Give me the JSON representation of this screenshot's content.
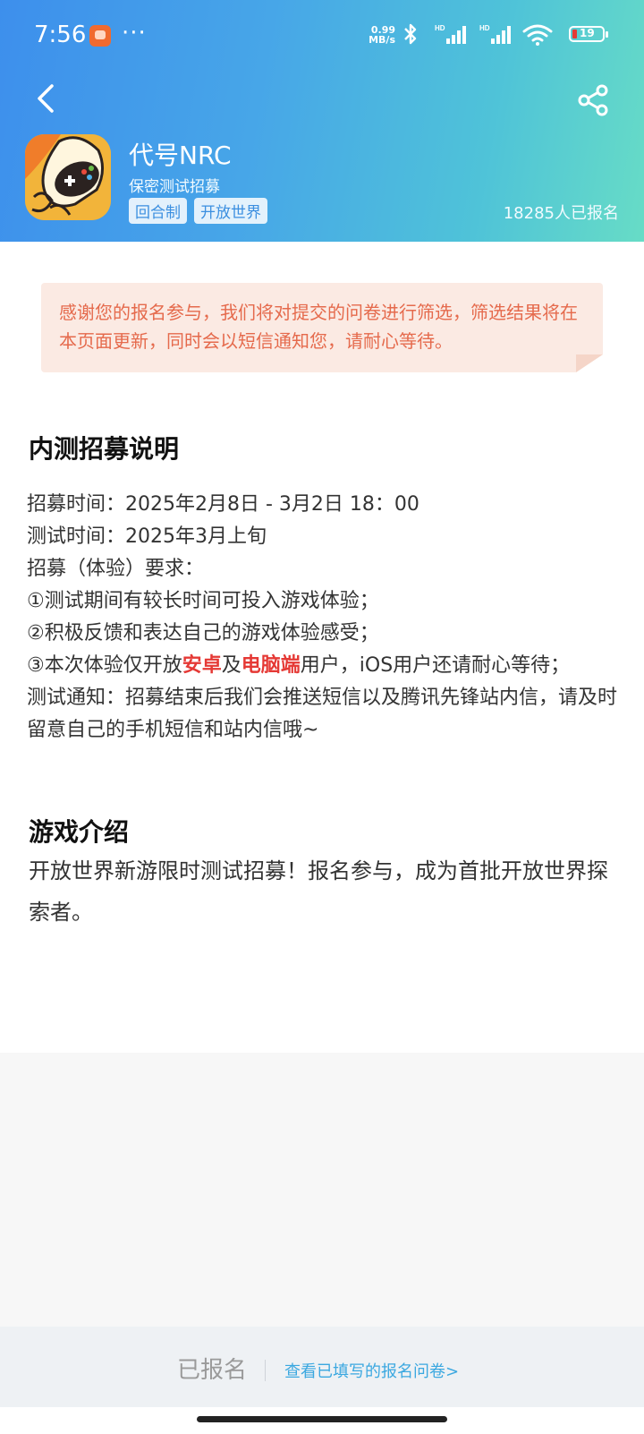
{
  "status_bar": {
    "time": "7:56",
    "more": "···",
    "net_speed_value": "0.99",
    "net_speed_unit": "MB/s",
    "battery": "19"
  },
  "header": {
    "title": "代号NRC",
    "subtitle": "保密测试招募",
    "tags": [
      "回合制",
      "开放世界"
    ],
    "signup_count": "18285人已报名"
  },
  "notice": {
    "text": "感谢您的报名参与，我们将对提交的问卷进行筛选，筛选结果将在本页面更新，同时会以短信通知您，请耐心等待。"
  },
  "recruit": {
    "heading": "内测招募说明",
    "time_line": "招募时间：2025年2月8日 - 3月2日 18：00",
    "test_time": "测试时间：2025年3月上旬",
    "requirements_title": "招募（体验）要求：",
    "req1": "①测试期间有较长时间可投入游戏体验；",
    "req2": "②积极反馈和表达自己的游戏体验感受；",
    "req3_prefix": "③本次体验仅开放",
    "req3_hl1": "安卓",
    "req3_mid": "及",
    "req3_hl2": "电脑端",
    "req3_suffix": "用户，iOS用户还请耐心等待；",
    "notify": "测试通知：招募结束后我们会推送短信以及腾讯先锋站内信，请及时留意自己的手机短信和站内信哦~"
  },
  "intro": {
    "heading": "游戏介绍",
    "text": "开放世界新游限时测试招募！报名参与，成为首批开放世界探索者。"
  },
  "bottom": {
    "status": "已报名",
    "link": "查看已填写的报名问卷>"
  },
  "colors": {
    "header_start": "#3d8fec",
    "header_end": "#67dcc6",
    "notice_bg": "#fbeae3",
    "notice_text": "#e56a4c",
    "highlight": "#e53935",
    "link": "#3ba8e0"
  }
}
